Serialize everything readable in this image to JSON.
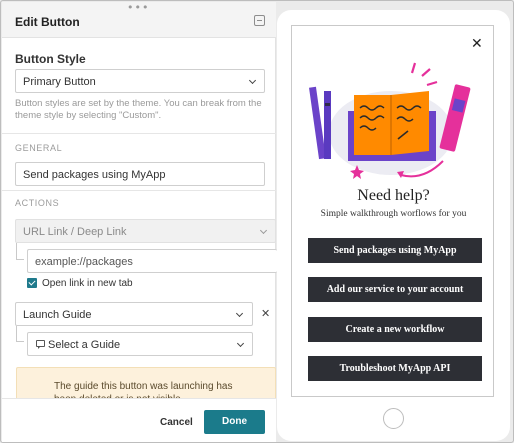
{
  "panel": {
    "title": "Edit Button",
    "button_style_label": "Button Style",
    "button_style_value": "Primary Button",
    "helper_text": "Button styles are set by the theme. You can break from the theme style by selecting \"Custom\".",
    "general_section": "GENERAL",
    "button_text_value": "Send packages using MyApp",
    "actions_section": "ACTIONS",
    "link_type_value": "URL Link / Deep Link",
    "url_placeholder": "example://packages",
    "open_new_tab_label": "Open link in new tab",
    "open_new_tab_checked": true,
    "action2_value": "Launch Guide",
    "guide_select_placeholder": "Select a Guide",
    "warning_text": "The guide this button was launching has been deleted or is not visible.",
    "cancel_label": "Cancel",
    "done_label": "Done"
  },
  "preview": {
    "title": "Need help?",
    "subtitle": "Simple walkthrough worflows for you",
    "buttons": [
      "Send packages using MyApp",
      "Add our service to your account",
      "Create a new workflow",
      "Troubleshoot MyApp API"
    ]
  },
  "colors": {
    "accent": "#1b7b8b",
    "preview_button": "#2d2f35",
    "warning_bg": "#fdf1dc",
    "illustration_orange": "#ff8a00",
    "illustration_purple": "#6b43c9",
    "illustration_pink": "#e5309b"
  },
  "icons": [
    "drag-handle-icon",
    "collapse-icon",
    "chevron-down-icon",
    "checkbox-checked-icon",
    "remove-icon",
    "chat-bubble-icon",
    "close-icon",
    "books-illustration"
  ]
}
